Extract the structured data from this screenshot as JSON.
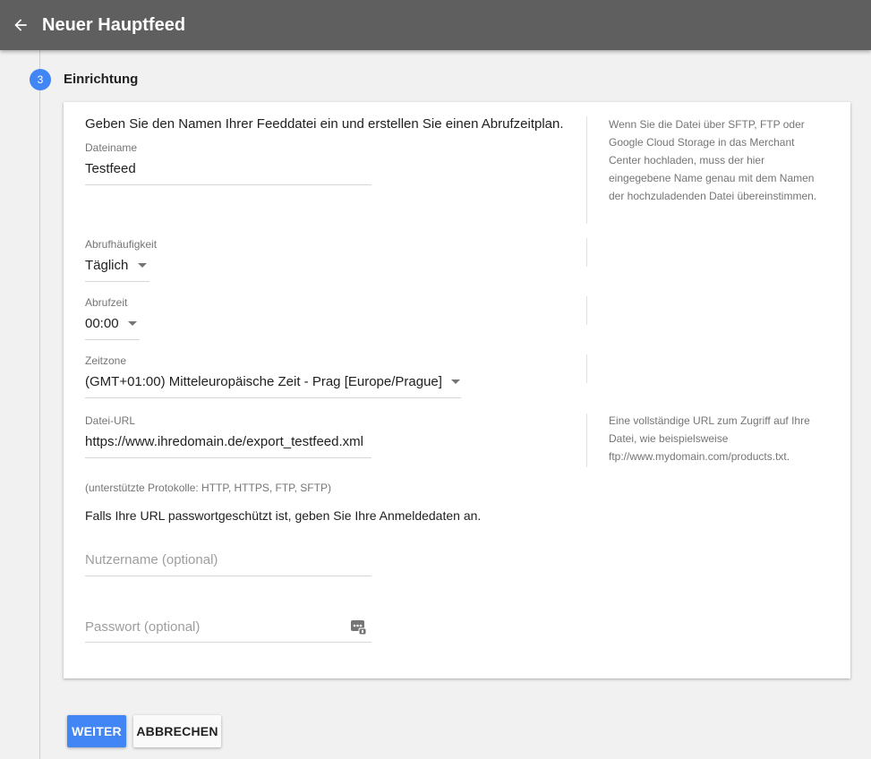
{
  "header": {
    "title": "Neuer Hauptfeed"
  },
  "step": {
    "number": "3",
    "title": "Einrichtung"
  },
  "form": {
    "intro": "Geben Sie den Namen Ihrer Feeddatei ein und erstellen Sie einen Abrufzeitplan.",
    "filename": {
      "label": "Dateiname",
      "value": "Testfeed"
    },
    "frequency": {
      "label": "Abrufhäufigkeit",
      "value": "Täglich"
    },
    "time": {
      "label": "Abrufzeit",
      "value": "00:00"
    },
    "timezone": {
      "label": "Zeitzone",
      "value": "(GMT+01:00) Mitteleuropäische Zeit - Prag [Europe/Prague]"
    },
    "url": {
      "label": "Datei-URL",
      "value": "https://www.ihredomain.de/export_testfeed.xml"
    },
    "protocols": "(unterstützte Protokolle: HTTP, HTTPS, FTP, SFTP)",
    "credentials_note": "Falls Ihre URL passwortgeschützt ist, geben Sie Ihre Anmeldedaten an.",
    "username": {
      "placeholder": "Nutzername (optional)"
    },
    "password": {
      "placeholder": "Passwort (optional)"
    }
  },
  "help": {
    "filename": "Wenn Sie die Datei über SFTP, FTP oder Google Cloud Storage in das Merchant Center hochladen, muss der hier eingegebene Name genau mit dem Namen der hochzuladenden Datei übereinstimmen.",
    "url": "Eine vollständige URL zum Zugriff auf Ihre Datei, wie beispielsweise ftp://www.mydomain.com/products.txt."
  },
  "buttons": {
    "continue": "WEITER",
    "cancel": "ABBRECHEN"
  },
  "colors": {
    "header": "#5f5f5f",
    "accent": "#4285f4"
  },
  "icons": {
    "back": "arrow-back-icon",
    "password": "password-dots-icon",
    "dropdown": "dropdown-caret-icon"
  }
}
